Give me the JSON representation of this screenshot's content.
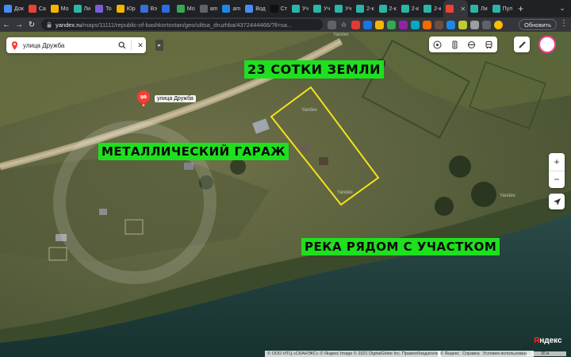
{
  "browser": {
    "tabs": [
      {
        "label": "Док",
        "color": "#4a8af4"
      },
      {
        "label": "Ca",
        "color": "#ea4335"
      },
      {
        "label": "Мо",
        "color": "#f4b400"
      },
      {
        "label": "Ли",
        "color": "#2bb5a6"
      },
      {
        "label": "То",
        "color": "#7b5cd6"
      },
      {
        "label": "Юр",
        "color": "#f4b400"
      },
      {
        "label": "Вэ",
        "color": "#3b6fd8"
      },
      {
        "label": "",
        "color": "#2a6de0"
      },
      {
        "label": "Мо",
        "color": "#34a853"
      },
      {
        "label": "am",
        "color": "#5f6368"
      },
      {
        "label": "am",
        "color": "#1e88e5"
      },
      {
        "label": "Вод",
        "color": "#4a8af4"
      },
      {
        "label": "Ст",
        "color": "#111111"
      },
      {
        "label": "Уч",
        "color": "#2bb5a6"
      },
      {
        "label": "Уч",
        "color": "#2bb5a6"
      },
      {
        "label": "Уч",
        "color": "#2bb5a6"
      },
      {
        "label": "2-к",
        "color": "#2bb5a6"
      },
      {
        "label": "2-к",
        "color": "#2bb5a6"
      },
      {
        "label": "2-к",
        "color": "#2bb5a6"
      },
      {
        "label": "2-к",
        "color": "#2bb5a6"
      },
      {
        "label": "",
        "color": "#ea4335",
        "active": true
      },
      {
        "label": "Ли",
        "color": "#2bb5a6"
      },
      {
        "label": "Пул",
        "color": "#2bb5a6"
      }
    ],
    "new_tab": "+",
    "url_host": "yandex.ru",
    "url_path": "/maps/11111/republic-of-bashkortostan/geo/ulitsa_druzhba/4372444466/?ll=sa...",
    "update_label": "Обновить"
  },
  "map": {
    "search_query": "улица Дружба",
    "poi_label": "улица Дружба",
    "annotations": {
      "land": "23 СОТКИ ЗЕМЛИ",
      "garage": "МЕТАЛЛИЧЕСКИЙ ГАРАЖ",
      "river": "РЕКА РЯДОМ С УЧАСТКОМ"
    },
    "watermarks": [
      "Yandex",
      "Yandex",
      "Yandex",
      "Yandex"
    ],
    "copyright": "© ООО ИТЦ «СКАНЭКС» © Яндекс Image © 2021 DigitalGlobe Inc.  Правообладатели",
    "footer_links": [
      "© Яндекс",
      "Справка",
      "Условия использования"
    ],
    "logo_prefix": "Я",
    "logo_rest": "ндекс",
    "scale": "30 м",
    "colors": {
      "annotation": "#1ee01e",
      "plot_outline": "#f5e31a",
      "water": "#1d3d3d",
      "accent": "#ff3b30"
    }
  }
}
